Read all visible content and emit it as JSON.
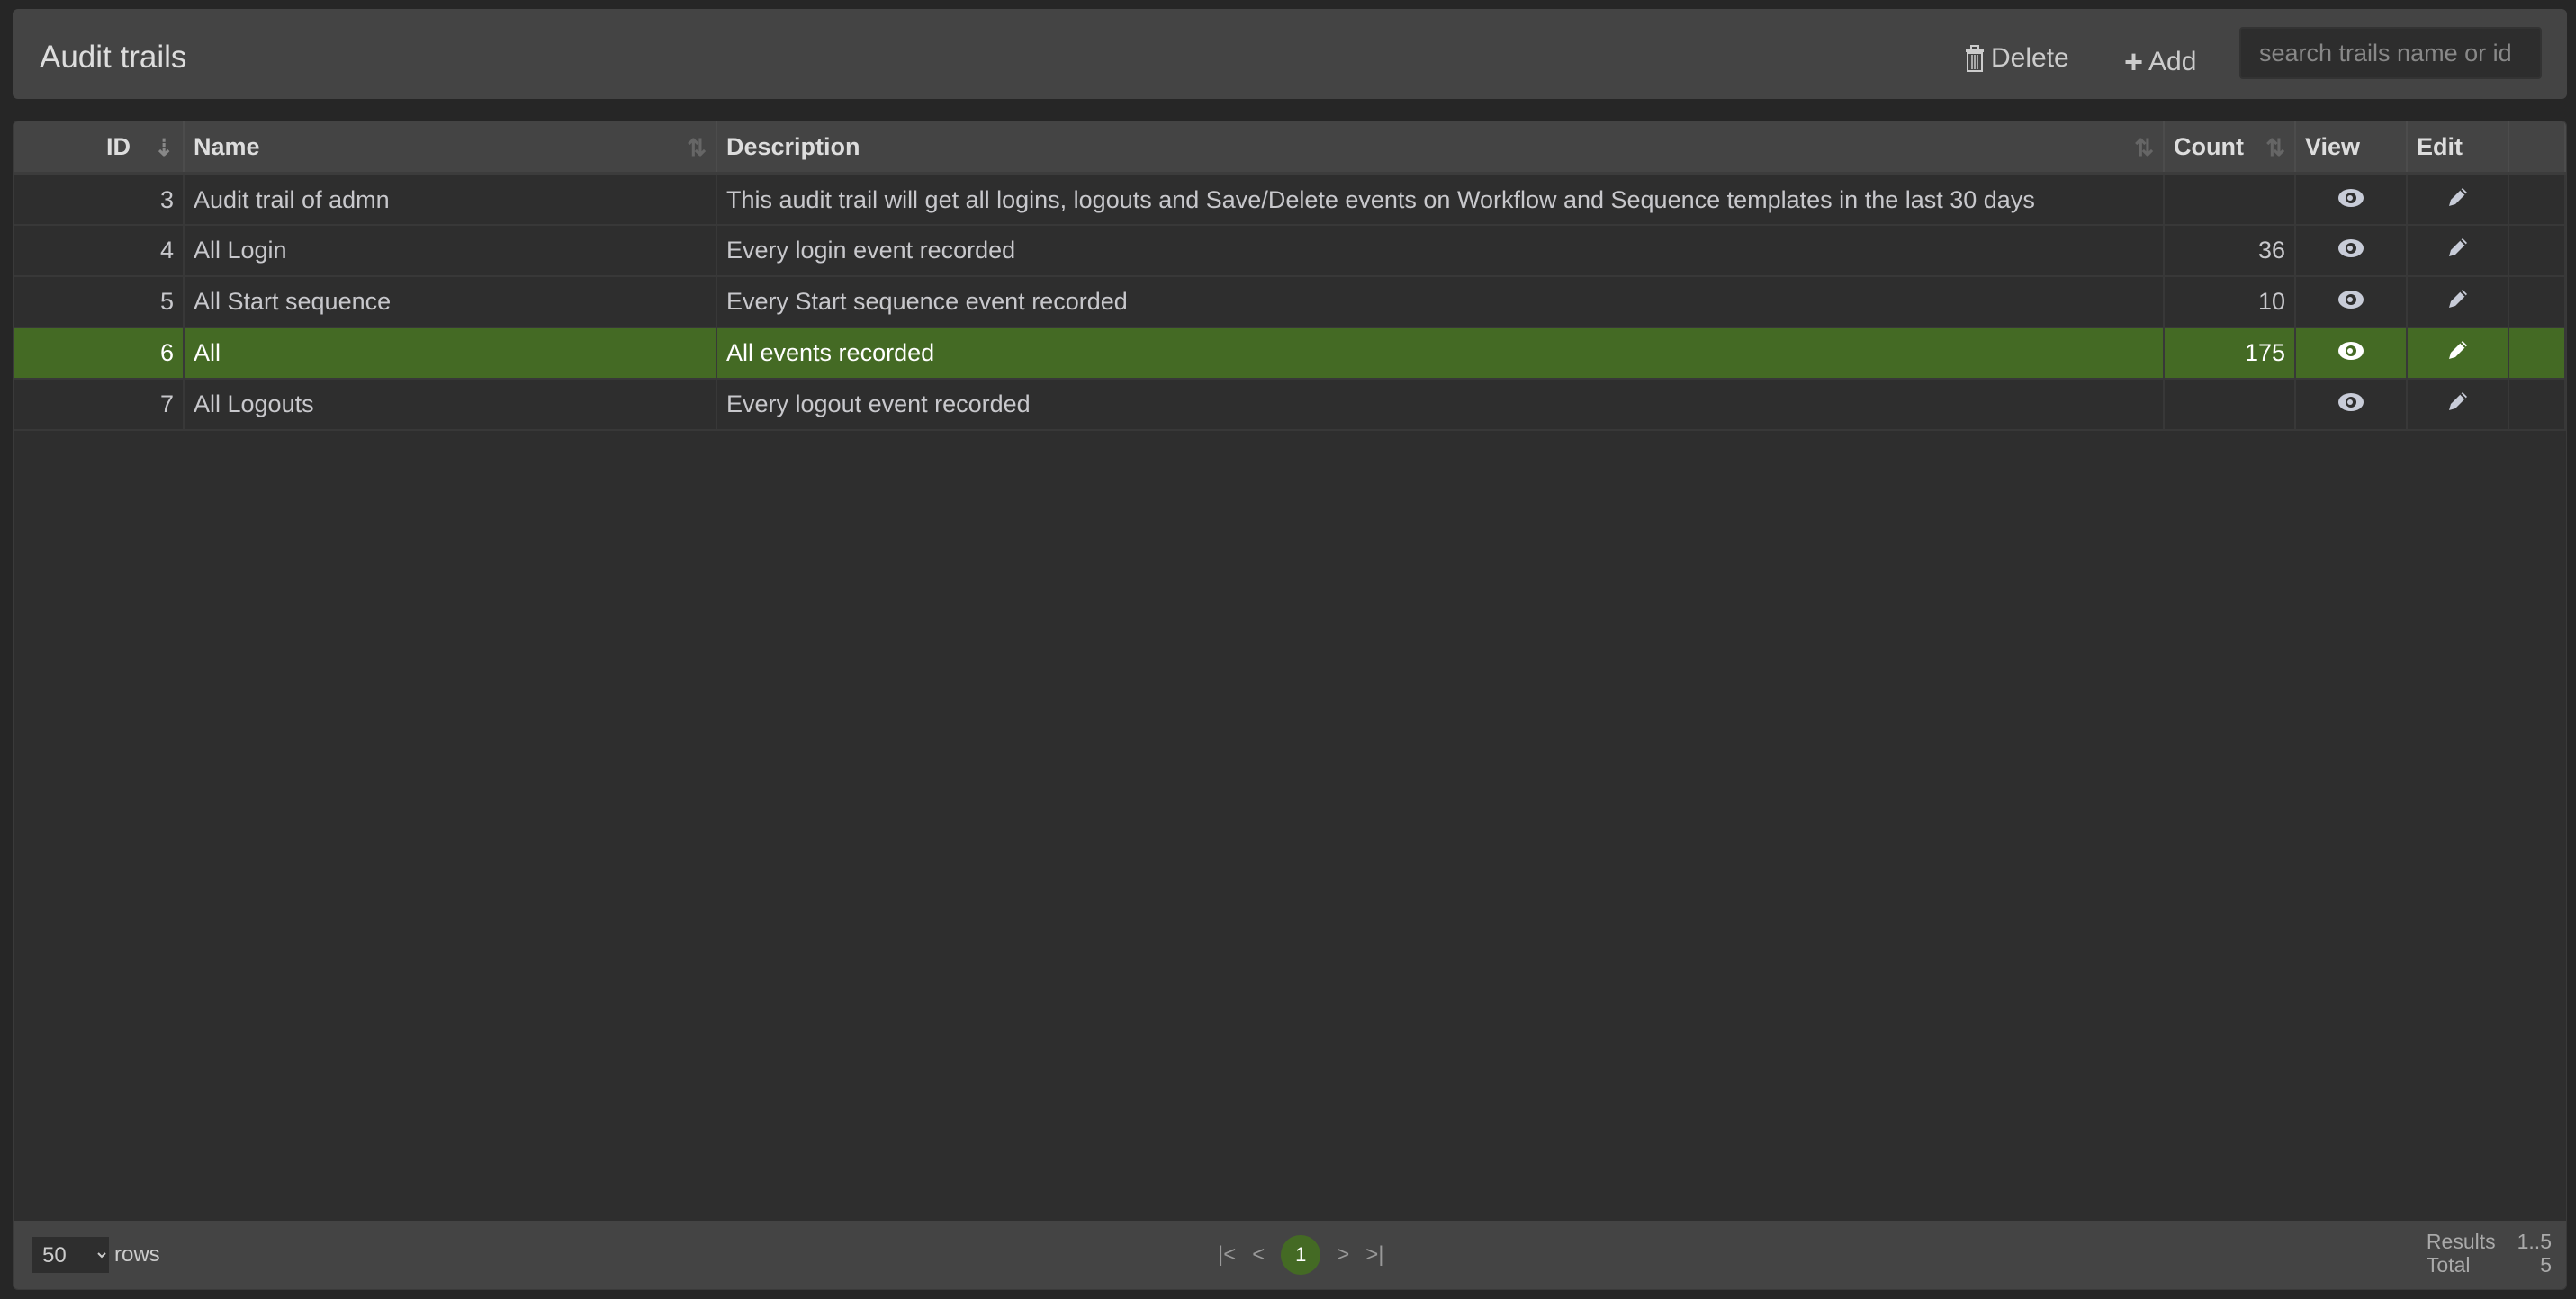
{
  "header": {
    "title": "Audit trails",
    "delete_label": "Delete",
    "add_label": "Add",
    "search_placeholder": "search trails name or id"
  },
  "table": {
    "columns": {
      "id": "ID",
      "name": "Name",
      "description": "Description",
      "count": "Count",
      "view": "View",
      "edit": "Edit"
    },
    "rows": [
      {
        "id": "3",
        "name": "Audit trail of admn",
        "description": "This audit trail will get all logins, logouts and Save/Delete events on Workflow and Sequence templates in the last 30 days",
        "count": ""
      },
      {
        "id": "4",
        "name": "All Login",
        "description": "Every login event recorded",
        "count": "36"
      },
      {
        "id": "5",
        "name": "All Start sequence",
        "description": "Every Start sequence event recorded",
        "count": "10"
      },
      {
        "id": "6",
        "name": "All",
        "description": "All events recorded",
        "count": "175",
        "selected": true
      },
      {
        "id": "7",
        "name": "All Logouts",
        "description": "Every logout event recorded",
        "count": ""
      }
    ]
  },
  "footer": {
    "rows_value": "50",
    "rows_label": "rows",
    "first": "|<",
    "prev": "<",
    "page": "1",
    "next": ">",
    "last": ">|",
    "results_label": "Results",
    "results_value": "1..5",
    "total_label": "Total",
    "total_value": "5"
  },
  "colors": {
    "accent": "#446a24",
    "background": "#262626",
    "panel": "#444444"
  }
}
